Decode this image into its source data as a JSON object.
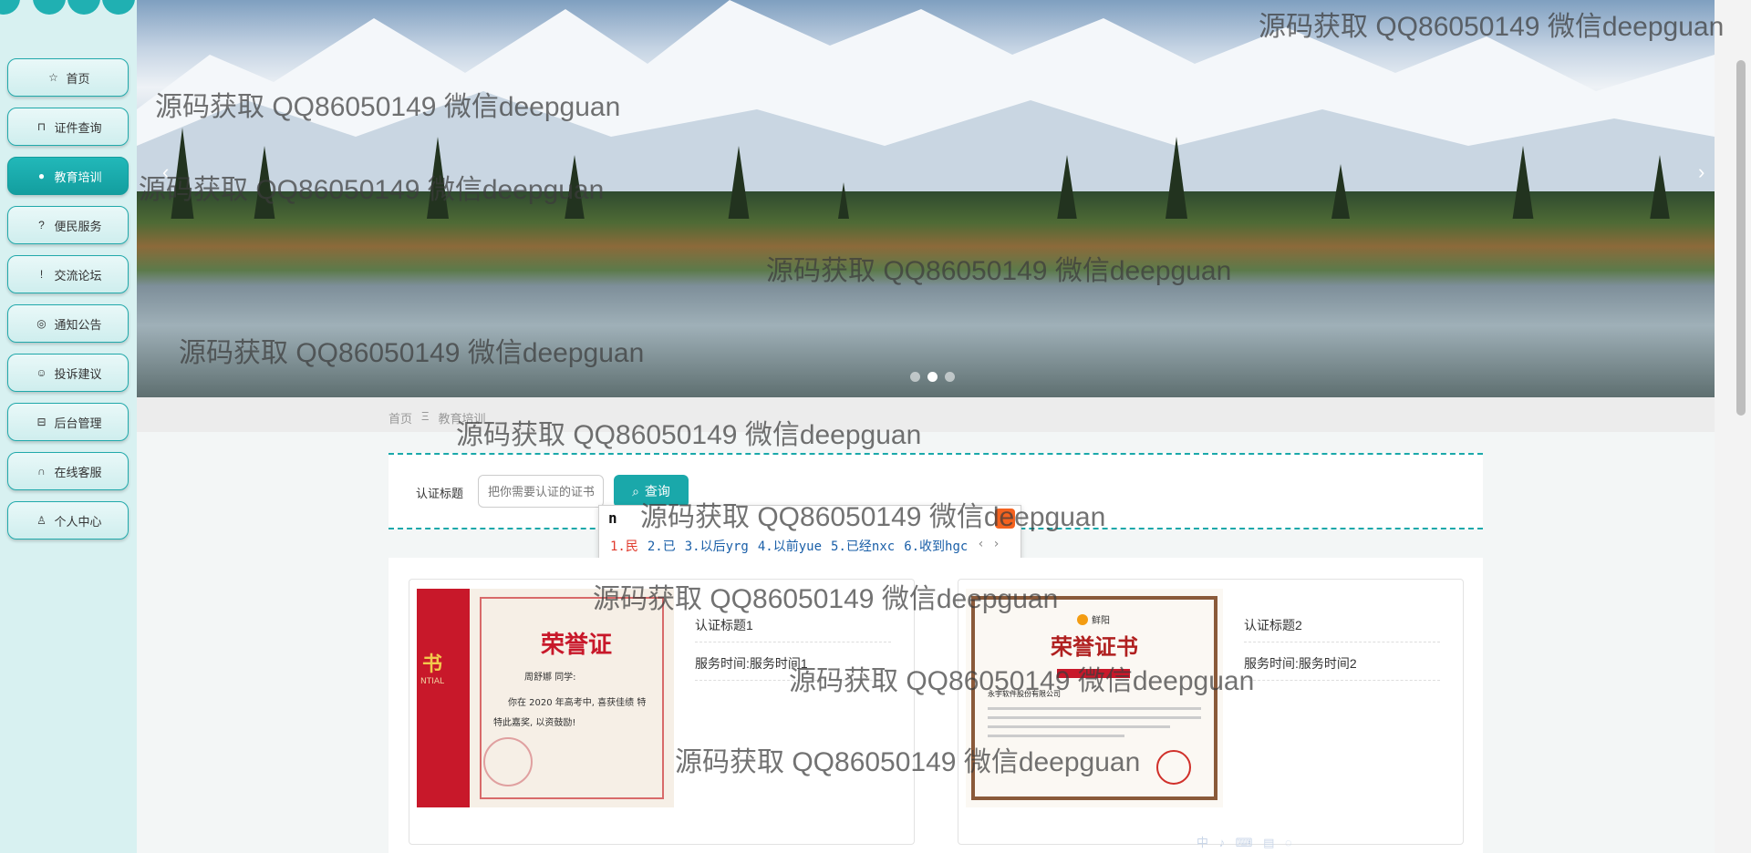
{
  "sidebar": {
    "items": [
      {
        "label": "首页",
        "icon": "star-icon"
      },
      {
        "label": "证件查询",
        "icon": "lock-icon"
      },
      {
        "label": "教育培训",
        "icon": "info-icon",
        "active": true
      },
      {
        "label": "便民服务",
        "icon": "help-icon"
      },
      {
        "label": "交流论坛",
        "icon": "alert-icon"
      },
      {
        "label": "通知公告",
        "icon": "bell-icon"
      },
      {
        "label": "投诉建议",
        "icon": "smile-icon"
      },
      {
        "label": "后台管理",
        "icon": "briefcase-icon"
      },
      {
        "label": "在线客服",
        "icon": "headset-icon"
      },
      {
        "label": "个人中心",
        "icon": "user-icon"
      }
    ]
  },
  "banner": {
    "prev": "‹",
    "next": "›",
    "active_slide_index": 1,
    "slide_count": 3
  },
  "breadcrumb": {
    "home": "首页",
    "separator": "Ξ",
    "current": "教育培训"
  },
  "search": {
    "label": "认证标题",
    "placeholder": "把你需要认证的证书",
    "button": "查询"
  },
  "ime": {
    "composition": "n",
    "candidates": [
      "1.民",
      "2.已",
      "3.以后yrg",
      "4.以前yue",
      "5.已经nxc",
      "6.收到hgc"
    ],
    "paging": "‹ ›"
  },
  "cards": [
    {
      "title": "认证标题1",
      "time": "服务时间:服务时间1"
    },
    {
      "title": "认证标题2",
      "time": "服务时间:服务时间2"
    }
  ],
  "cert1": {
    "heading": "荣誉证",
    "side": "书",
    "side_sub": "NTIAL",
    "name": "周舒娜 同学:",
    "line1": "你在 2020 年高考中, 喜获佳绩 特",
    "line2": "特此嘉奖, 以资鼓励!"
  },
  "cert2": {
    "brand": "鲜阳",
    "heading": "荣誉证书",
    "company": "永宇软件股份有限公司"
  },
  "watermark": "源码获取 QQ86050149 微信deepguan",
  "tray": "中 ♪ ⌨ ▤ ◌",
  "colors": {
    "accent": "#1aa8aa",
    "sidebar_bg": "#d8f1f1",
    "cert_red": "#c8182a"
  }
}
